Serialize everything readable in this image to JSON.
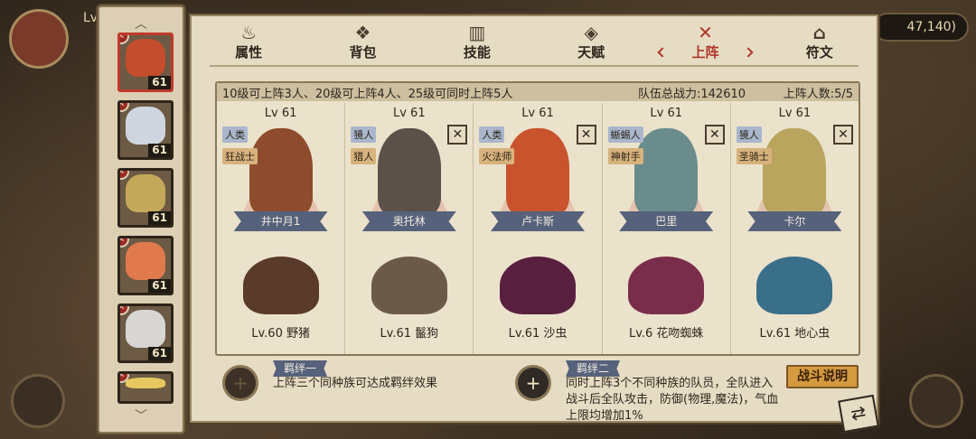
{
  "background": {
    "level_text": "Lv",
    "currency_value": "47,140)"
  },
  "roster": [
    {
      "level": "61",
      "face_color": "#c44d2e",
      "selected": true
    },
    {
      "level": "61",
      "face_color": "#d0d6df"
    },
    {
      "level": "61",
      "face_color": "#c5a95a"
    },
    {
      "level": "61",
      "face_color": "#e07a4d"
    },
    {
      "level": "61",
      "face_color": "#d7d6d2"
    },
    {
      "level": "",
      "face_color": "#e6c860"
    }
  ],
  "tabs": [
    {
      "label": "属性",
      "icon": "flame-icon",
      "glyph": "♨"
    },
    {
      "label": "背包",
      "icon": "bag-icon",
      "glyph": "❖"
    },
    {
      "label": "技能",
      "icon": "book-icon",
      "glyph": "▥"
    },
    {
      "label": "天赋",
      "icon": "eye-icon",
      "glyph": "◈"
    },
    {
      "label": "上阵",
      "icon": "crossed-swords-icon",
      "glyph": "✕",
      "active": true
    },
    {
      "label": "符文",
      "icon": "rune-icon",
      "glyph": "⌂"
    }
  ],
  "team": {
    "rule_text": "10级可上阵3人、20级可上阵4人、25级可同时上阵5人",
    "power_text": "队伍总战力:142610",
    "count_text": "上阵人数:5/5"
  },
  "slots": [
    {
      "level": "Lv 61",
      "race": "人类",
      "class": "狂战士",
      "name": "井中月1",
      "pet": "Lv.60 野猪",
      "removable": false,
      "hero_color": "#8f4b2d",
      "pet_color": "#5a3a2a"
    },
    {
      "level": "Lv 61",
      "race": "獍人",
      "class": "猎人",
      "name": "奥托林",
      "pet": "Lv.61 鬣狗",
      "removable": true,
      "hero_color": "#5b5149",
      "pet_color": "#6b5a4a"
    },
    {
      "level": "Lv 61",
      "race": "人类",
      "class": "火法师",
      "name": "卢卡斯",
      "pet": "Lv.61 沙虫",
      "removable": true,
      "hero_color": "#c9532d",
      "pet_color": "#5a2040"
    },
    {
      "level": "Lv 61",
      "race": "蜥蜴人",
      "class": "神射手",
      "name": "巴里",
      "pet": "Lv.6 花吻蜘蛛",
      "removable": true,
      "hero_color": "#6a8c8c",
      "pet_color": "#7a2d4a"
    },
    {
      "level": "Lv 61",
      "race": "獍人",
      "class": "圣骑士",
      "name": "卡尔",
      "pet": "Lv.61 地心虫",
      "removable": true,
      "hero_color": "#b9a55e",
      "pet_color": "#3a6f8a"
    }
  ],
  "bonds": [
    {
      "title": "羁绊一",
      "desc": "上阵三个同种族可达成羁绊效果"
    },
    {
      "title": "羁绊二",
      "desc": "同时上阵3个不同种族的队员，全队进入战斗后全队攻击，防御(物理,魔法)，气血上限均增加1%"
    }
  ],
  "battle_button": "战斗说明"
}
